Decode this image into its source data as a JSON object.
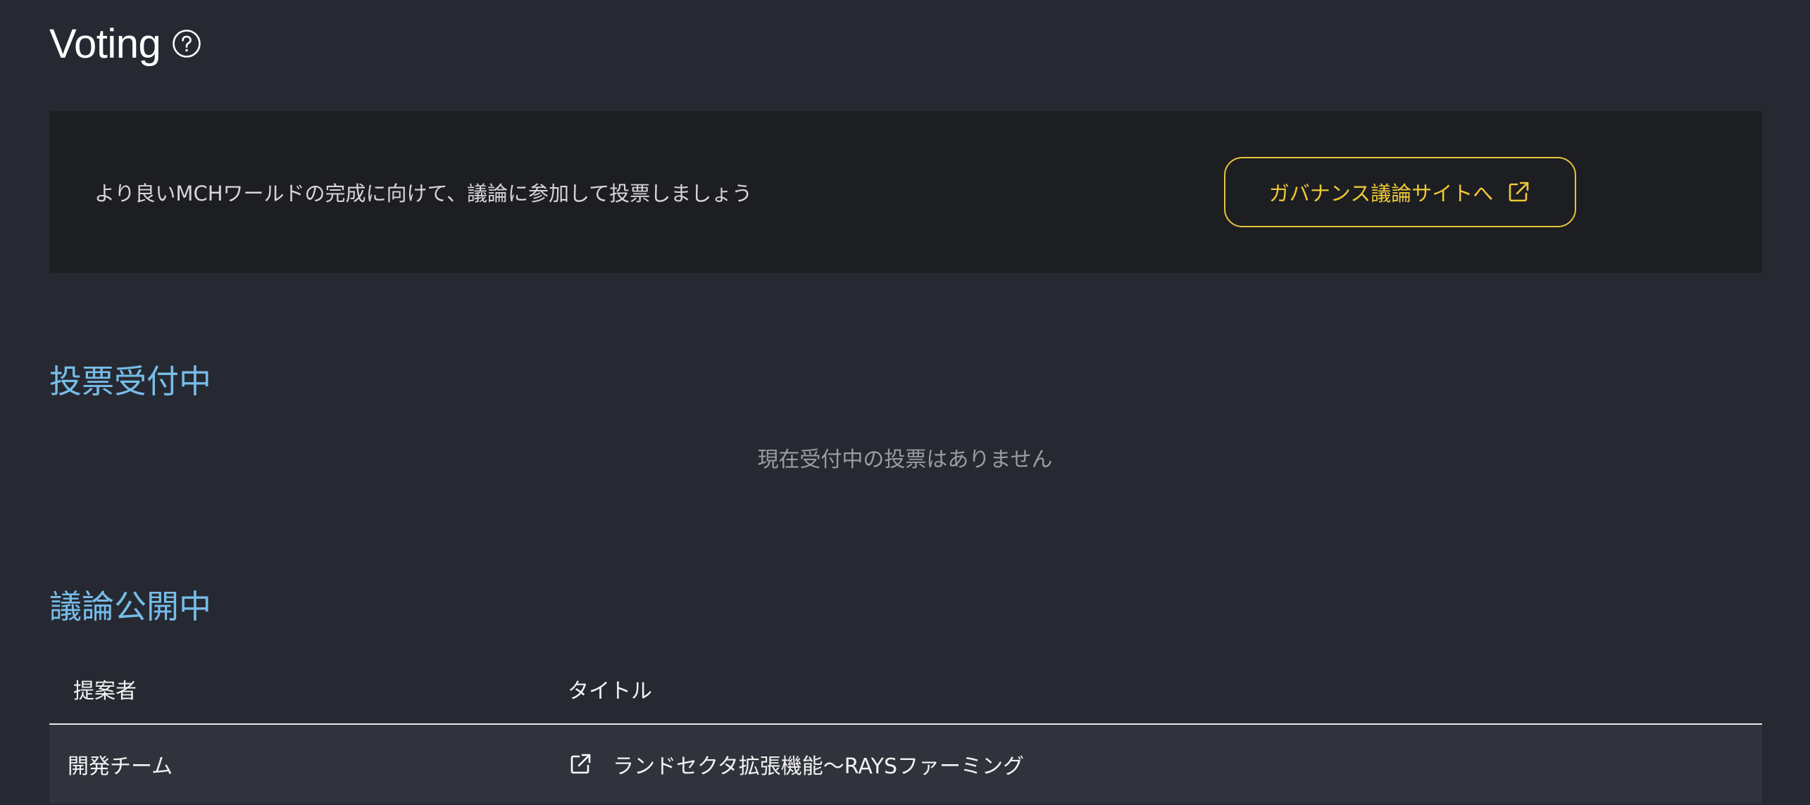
{
  "header": {
    "title": "Voting",
    "help_icon": "help-circle-icon"
  },
  "banner": {
    "text": "より良いMCHワールドの完成に向けて、議論に参加して投票しましょう",
    "button_label": "ガバナンス議論サイトへ",
    "button_icon": "external-link-icon",
    "accent_color": "#e8c33d"
  },
  "voting_open": {
    "heading": "投票受付中",
    "empty_message": "現在受付中の投票はありません"
  },
  "discussions": {
    "heading": "議論公開中",
    "columns": [
      "提案者",
      "タイトル"
    ],
    "rows": [
      {
        "proposer": "開発チーム",
        "title": "ランドセクタ拡張機能〜RAYSファーミング",
        "icon": "external-link-icon"
      }
    ]
  },
  "colors": {
    "background": "#262931",
    "banner_bg": "#1d1e22",
    "heading_blue": "#77bde9",
    "row_bg": "#30333b"
  }
}
